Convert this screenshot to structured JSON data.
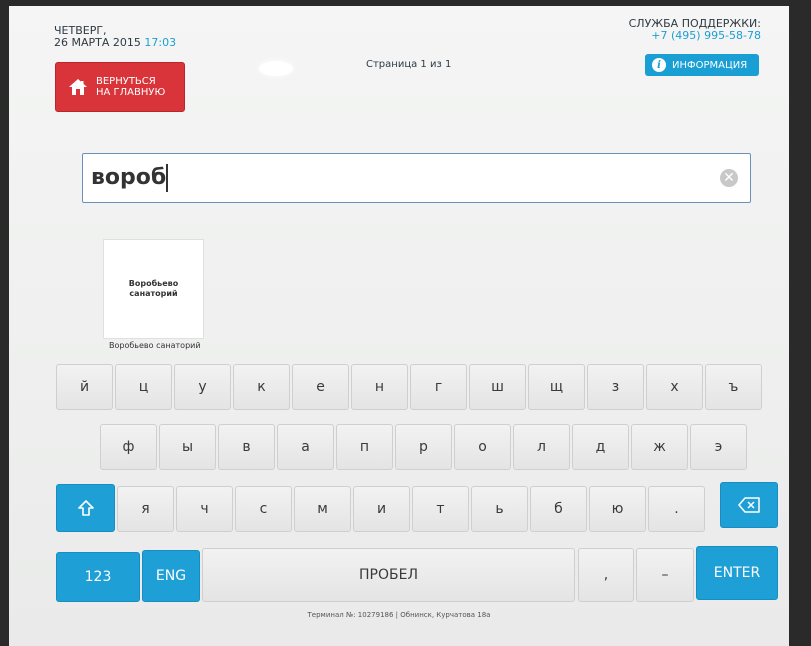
{
  "header": {
    "date_line1": "ЧЕТВЕРГ,",
    "date_line2": "26 МАРТА 2015",
    "time": "17:03",
    "support_title": "СЛУЖБА ПОДДЕРЖКИ:",
    "support_phone": "+7 (495) 995-58-78",
    "home_label_line1": "ВЕРНУТЬСЯ",
    "home_label_line2": "НА ГЛАВНУЮ",
    "page_indicator": "Страница 1 из 1",
    "info_label": "ИНФОРМАЦИЯ",
    "info_icon_glyph": "i"
  },
  "search": {
    "value": "вороб",
    "clear_glyph": "✕"
  },
  "results": [
    {
      "thumb_line1": "Воробьево",
      "thumb_line2": "санаторий",
      "caption": "Воробьево санаторий"
    }
  ],
  "keyboard": {
    "row1": [
      "й",
      "ц",
      "у",
      "к",
      "е",
      "н",
      "г",
      "ш",
      "щ",
      "з",
      "х",
      "ъ"
    ],
    "row2": [
      "ф",
      "ы",
      "в",
      "а",
      "п",
      "р",
      "о",
      "л",
      "д",
      "ж",
      "э"
    ],
    "row3": [
      "я",
      "ч",
      "с",
      "м",
      "и",
      "т",
      "ь",
      "б",
      "ю",
      "."
    ],
    "shift_icon": "arrow-up-outline",
    "backspace_icon": "backspace",
    "num_label": "123",
    "lang_label": "ENG",
    "space_label": "ПРОБЕЛ",
    "comma_label": ",",
    "dash_label": "–",
    "enter_label": "ENTER"
  },
  "footer": {
    "terminal_text": "Терминал №: 10279186 | Обнинск, Курчатова 18а"
  },
  "colors": {
    "accent_blue": "#1a9fd4",
    "home_red": "#d8343a"
  }
}
